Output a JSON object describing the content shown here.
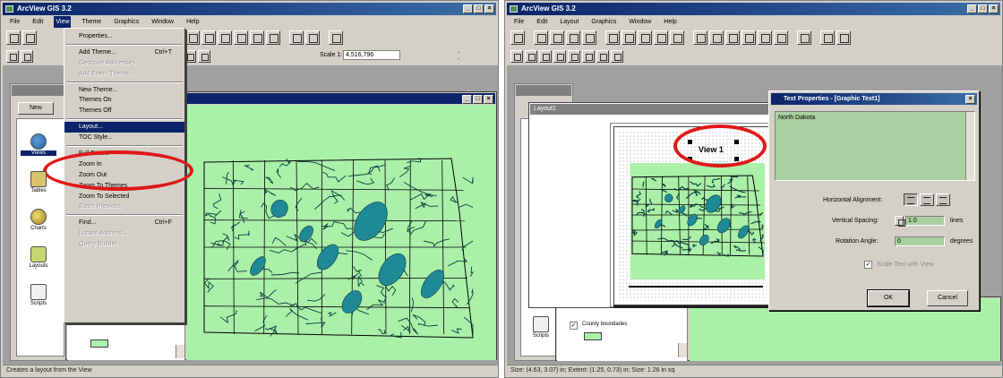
{
  "left": {
    "app_title": "ArcView GIS 3.2",
    "menus": [
      "File",
      "Edit",
      "View",
      "Theme",
      "Graphics",
      "Window",
      "Help"
    ],
    "active_menu": "View",
    "scale_label": "Scale 1:",
    "scale_value": "4,516,796",
    "coords": [
      "-",
      "-"
    ],
    "view_menu_items": [
      {
        "label": "Properties...",
        "shortcut": "",
        "enabled": true,
        "sep_after": true
      },
      {
        "label": "Add Theme...",
        "shortcut": "Ctrl+T",
        "enabled": true,
        "sep_after": false
      },
      {
        "label": "Geocode Addresses...",
        "shortcut": "",
        "enabled": false,
        "sep_after": false
      },
      {
        "label": "Add Event Theme...",
        "shortcut": "",
        "enabled": false,
        "sep_after": true
      },
      {
        "label": "New Theme...",
        "shortcut": "",
        "enabled": true,
        "sep_after": false
      },
      {
        "label": "Themes On",
        "shortcut": "",
        "enabled": true,
        "sep_after": false
      },
      {
        "label": "Themes Off",
        "shortcut": "",
        "enabled": true,
        "sep_after": true
      },
      {
        "label": "Layout...",
        "shortcut": "",
        "enabled": true,
        "highlighted": true,
        "sep_after": false
      },
      {
        "label": "TOC Style...",
        "shortcut": "",
        "enabled": true,
        "sep_after": true
      },
      {
        "label": "Full Extent",
        "shortcut": "",
        "enabled": true,
        "sep_after": false
      },
      {
        "label": "Zoom In",
        "shortcut": "",
        "enabled": true,
        "sep_after": false
      },
      {
        "label": "Zoom Out",
        "shortcut": "",
        "enabled": true,
        "sep_after": false
      },
      {
        "label": "Zoom To Themes",
        "shortcut": "",
        "enabled": true,
        "sep_after": false
      },
      {
        "label": "Zoom To Selected",
        "shortcut": "",
        "enabled": true,
        "sep_after": false
      },
      {
        "label": "Zoom Previous",
        "shortcut": "",
        "enabled": false,
        "sep_after": true
      },
      {
        "label": "Find...",
        "shortcut": "Ctrl+F",
        "enabled": true,
        "sep_after": false
      },
      {
        "label": "Locate Address...",
        "shortcut": "",
        "enabled": false,
        "sep_after": false
      },
      {
        "label": "Query Builder...",
        "shortcut": "",
        "enabled": false,
        "sep_after": false
      }
    ],
    "project_new_btn": "New",
    "project_items": [
      "Views",
      "Tables",
      "Charts",
      "Layouts",
      "Scripts"
    ],
    "status": "Creates a layout from the View"
  },
  "right": {
    "app_title": "ArcView GIS 3.2",
    "menus": [
      "File",
      "Edit",
      "Layout",
      "Graphics",
      "Window",
      "Help"
    ],
    "layout_window_title": "Layout1",
    "view_frame_text": "View 1",
    "legend_theme": "County boundaries",
    "status": "Size: (4.63, 3.07) in; Extent: (1.25, 0.73) in; Size: 1.26 in sq",
    "dialog": {
      "title": "Text Properties - [Graphic Text1]",
      "text_value": "North Dakota",
      "h_align_label": "Horizontal Alignment:",
      "v_spacing_label": "Vertical Spacing:",
      "v_spacing_value": "1.0",
      "v_spacing_unit": "lines",
      "rotation_label": "Rotation Angle:",
      "rotation_value": "0",
      "rotation_unit": "degrees",
      "scale_checkbox_label": "Scale Text with View",
      "ok_label": "OK",
      "cancel_label": "Cancel"
    }
  },
  "colors": {
    "map_fill": "#aaf0a8",
    "water": "#1f8a96",
    "highlight": "#0a246a",
    "annotation": "#e01818"
  }
}
